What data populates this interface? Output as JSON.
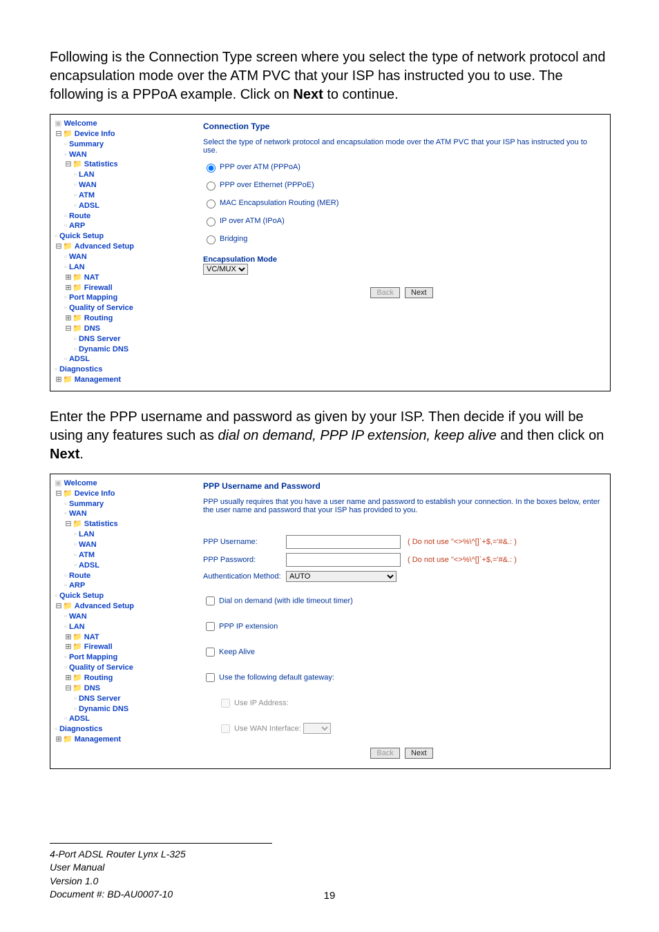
{
  "para1_a": "Following is the Connection Type screen where you select the type of network protocol and encapsulation mode over the ATM PVC that your ISP has instructed you to use.  The following is a PPPoA example.  Click on ",
  "para1_b": "Next",
  "para1_c": " to continue.",
  "para2_a": "Enter the PPP username and password as given by your ISP. Then decide if you will be using any features such as ",
  "para2_b": "dial on demand, PPP IP extension, keep alive",
  "para2_c": " and then click on ",
  "para2_d": "Next",
  "para2_e": ".",
  "tree": {
    "welcome": "Welcome",
    "device": "Device Info",
    "summary": "Summary",
    "wan": "WAN",
    "stats": "Statistics",
    "lan": "LAN",
    "atm": "ATM",
    "adsl": "ADSL",
    "route": "Route",
    "arp": "ARP",
    "quick": "Quick Setup",
    "adv": "Advanced Setup",
    "nat": "NAT",
    "fw": "Firewall",
    "pm": "Port Mapping",
    "qos": "Quality of Service",
    "routing": "Routing",
    "dns": "DNS",
    "dnss": "DNS Server",
    "ddns": "Dynamic DNS",
    "diag": "Diagnostics",
    "mgmt": "Management"
  },
  "ct": {
    "title": "Connection Type",
    "note": "Select the type of network protocol and encapsulation mode over the ATM PVC that your ISP has instructed you to use.",
    "r1": "PPP over ATM (PPPoA)",
    "r2": "PPP over Ethernet (PPPoE)",
    "r3": "MAC Encapsulation Routing (MER)",
    "r4": "IP over ATM (IPoA)",
    "r5": "Bridging",
    "encTitle": "Encapsulation Mode",
    "encVal": "VC/MUX",
    "back": "Back",
    "next": "Next"
  },
  "ppp": {
    "title": "PPP Username and Password",
    "note": "PPP usually requires that you have a user name and password to establish your connection. In the boxes below, enter the user name and password that your ISP has provided to you.",
    "user": "PPP Username:",
    "pass": "PPP Password:",
    "auth": "Authentication Method:",
    "authVal": "AUTO",
    "hint": "( Do not use \"<>%\\^[]`+$,='#&.: )",
    "dial": "Dial on demand (with idle timeout timer)",
    "ext": "PPP IP extension",
    "keep": "Keep Alive",
    "gw": "Use the following default gateway:",
    "ip": "Use IP Address:",
    "wanif": "Use WAN Interface:",
    "back": "Back",
    "next": "Next"
  },
  "footer": {
    "l1": "4-Port ADSL Router Lynx L-325",
    "l2": "User Manual",
    "l3": "Version 1.0",
    "l4": "Document #:  BD-AU0007-10",
    "page": "19"
  },
  "chart_data": null
}
